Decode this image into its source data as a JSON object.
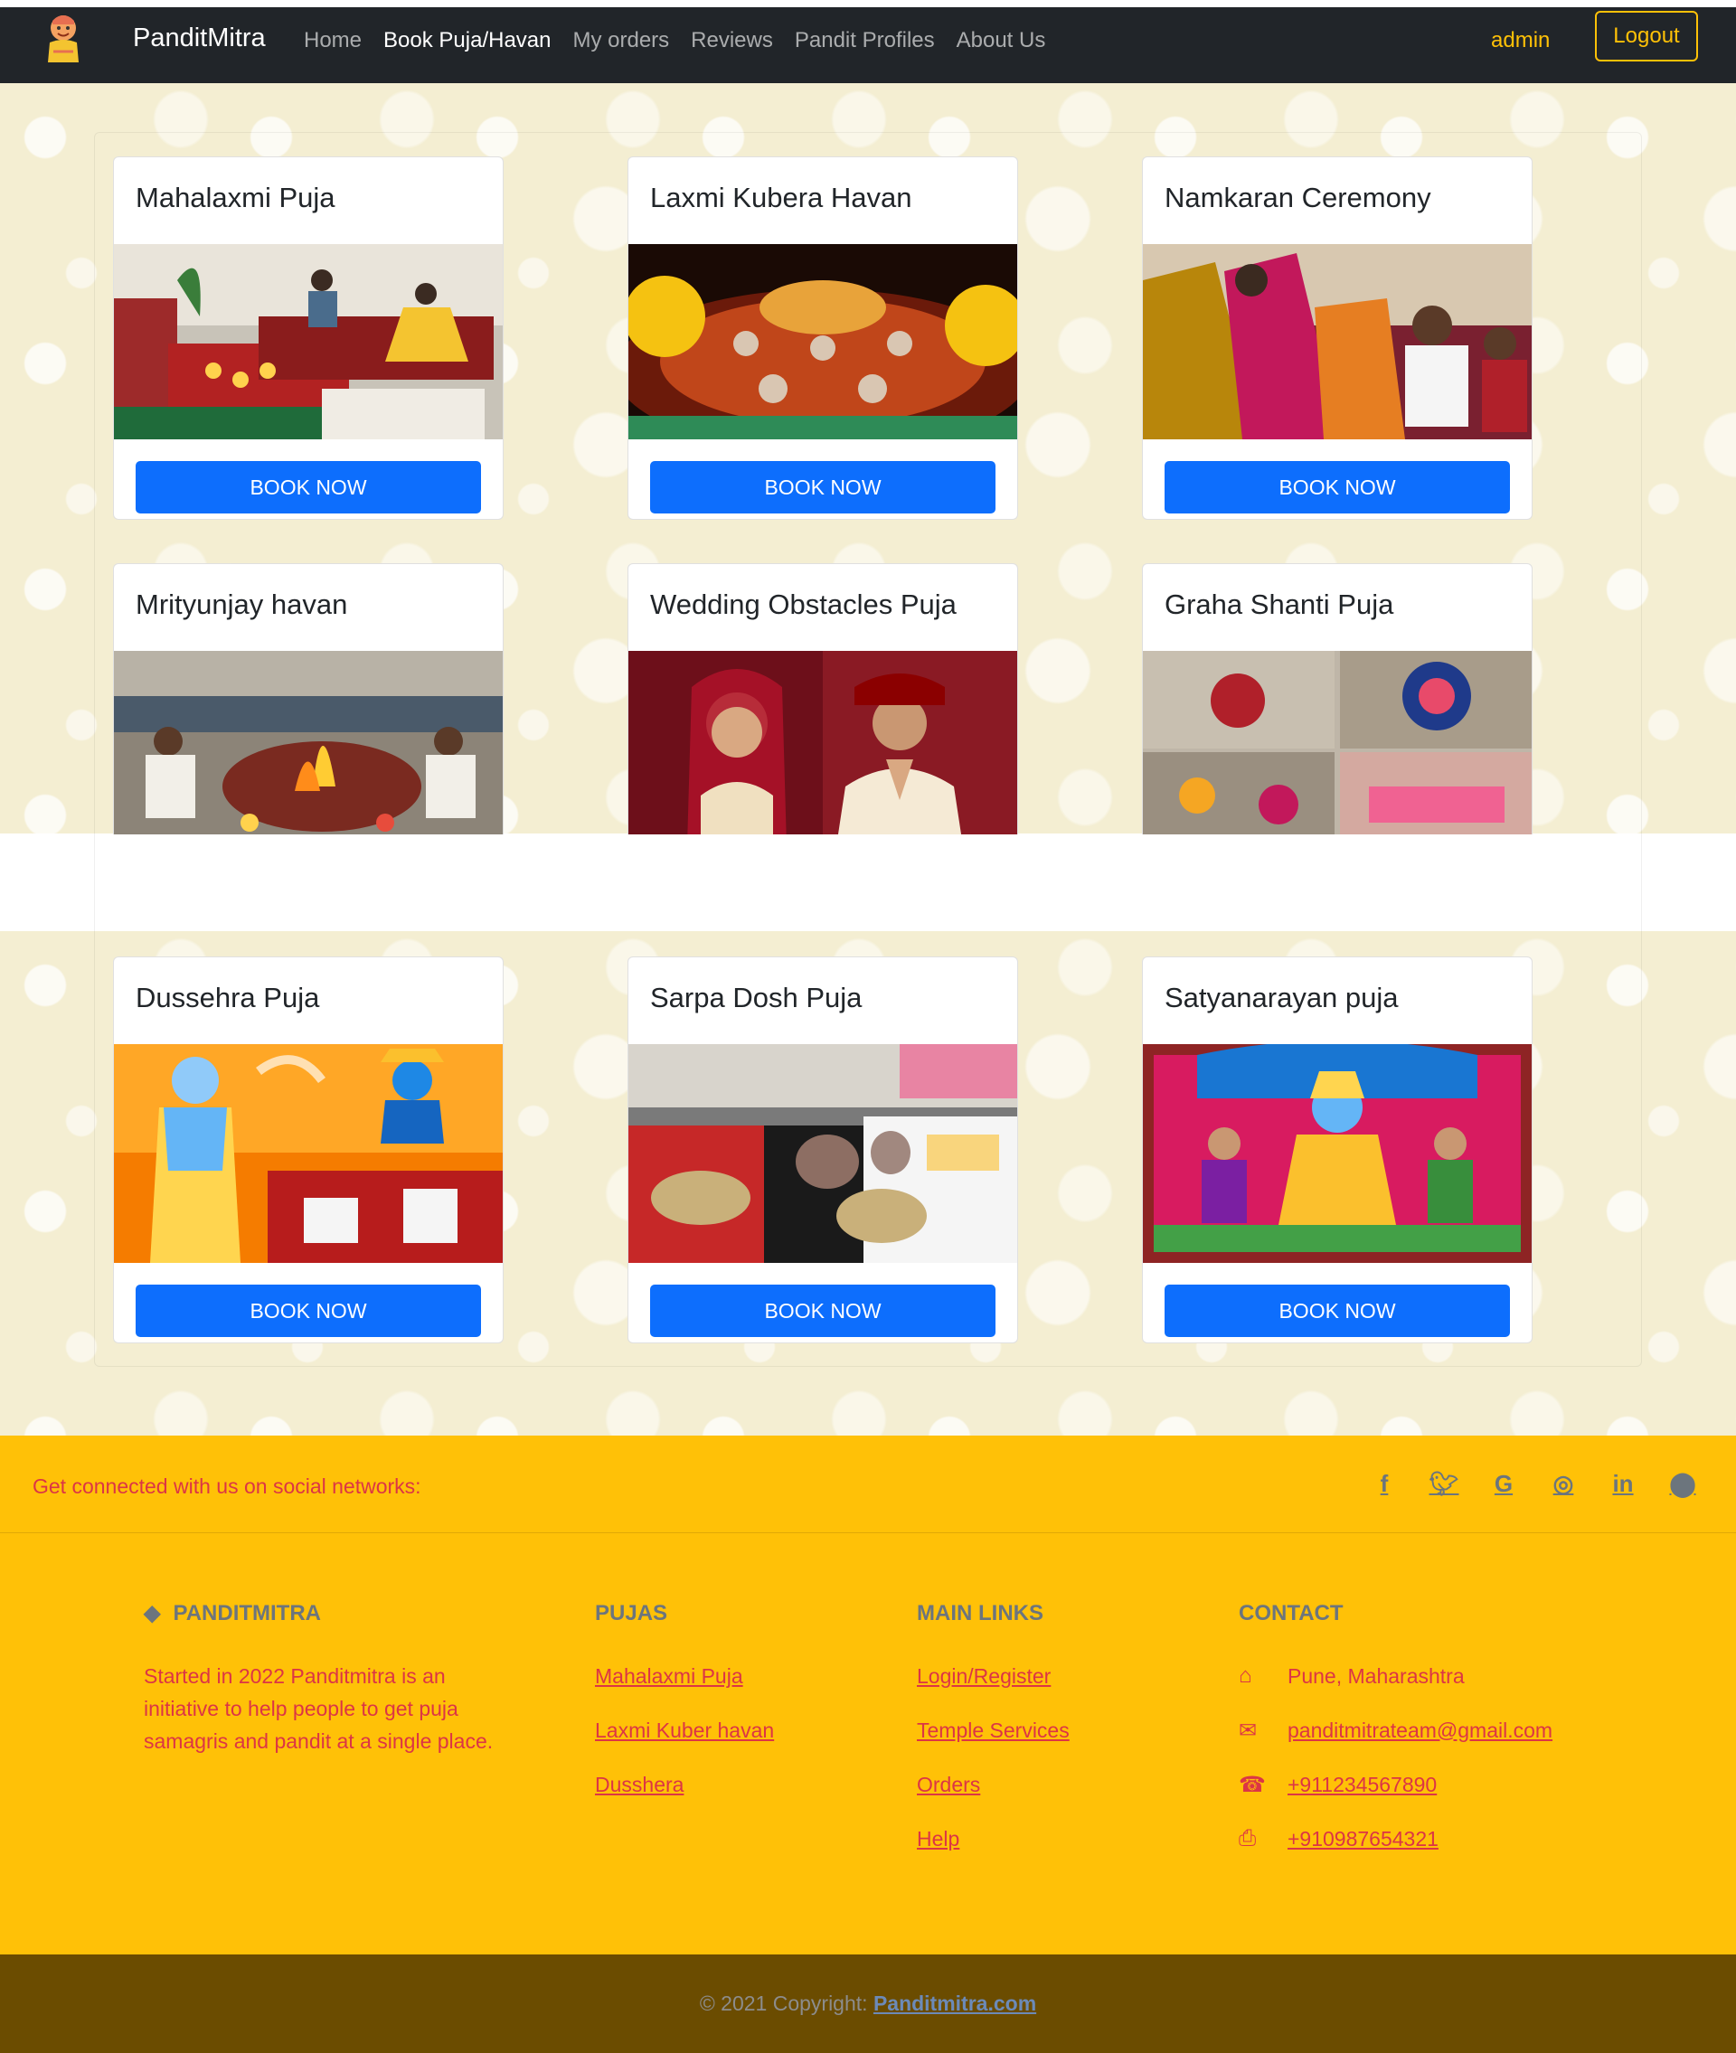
{
  "navbar": {
    "brand": "PanditMitra",
    "links": [
      "Home",
      "Book Puja/Havan",
      "My orders",
      "Reviews",
      "Pandit Profiles",
      "About Us"
    ],
    "active_index": 1,
    "user": "admin",
    "logout_label": "Logout"
  },
  "pujas": [
    {
      "title": "Mahalaxmi Puja",
      "button": "BOOK NOW"
    },
    {
      "title": "Laxmi Kubera Havan",
      "button": "BOOK NOW"
    },
    {
      "title": "Namkaran Ceremony",
      "button": "BOOK NOW"
    },
    {
      "title": "Mrityunjay havan"
    },
    {
      "title": "Wedding Obstacles Puja"
    },
    {
      "title": "Graha Shanti Puja"
    },
    {
      "title": "Dussehra Puja",
      "button": "BOOK NOW"
    },
    {
      "title": "Sarpa Dosh Puja",
      "button": "BOOK NOW"
    },
    {
      "title": "Satyanarayan puja",
      "button": "BOOK NOW"
    }
  ],
  "footer": {
    "social_text": "Get connected with us on social networks:",
    "social_icons": [
      "facebook-icon",
      "twitter-icon",
      "google-icon",
      "instagram-icon",
      "linkedin-icon",
      "github-icon"
    ],
    "about": {
      "heading": "PANDITMITRA",
      "text": "Started in 2022 Panditmitra is an initiative to help people to get puja samagris and pandit at a single place."
    },
    "pujas": {
      "heading": "PUJAS",
      "links": [
        "Mahalaxmi Puja",
        "Laxmi Kuber havan",
        "Dusshera"
      ]
    },
    "main_links": {
      "heading": "MAIN LINKS",
      "links": [
        "Login/Register",
        "Temple Services",
        "Orders",
        "Help"
      ]
    },
    "contact": {
      "heading": "CONTACT",
      "address": "Pune, Maharashtra",
      "email": "panditmitrateam@gmail.com",
      "phone": "+911234567890",
      "fax": "+910987654321"
    }
  },
  "copyright": {
    "prefix": "© 2021 Copyright: ",
    "site": "Panditmitra.com"
  },
  "colors": {
    "navbar": "#212529",
    "accent": "#ffc107",
    "button": "#0d6efd",
    "footer_text": "#dc3545",
    "footer_bottom": "#6b4c00"
  }
}
